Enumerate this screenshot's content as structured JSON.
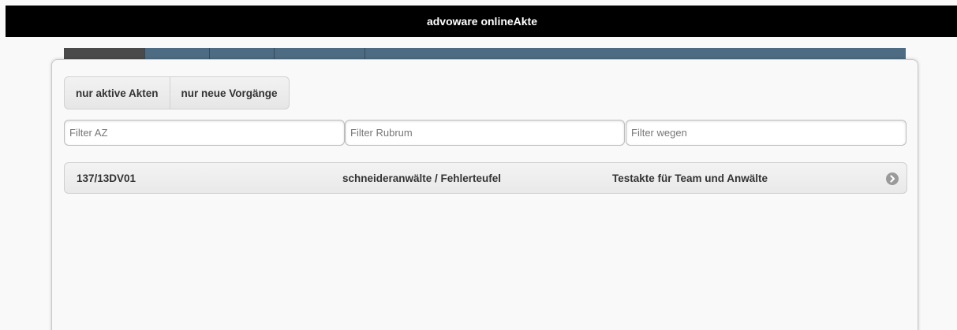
{
  "header": {
    "title": "advoware onlineAkte"
  },
  "tabs": [
    {
      "label": ""
    },
    {
      "label": ""
    },
    {
      "label": ""
    },
    {
      "label": ""
    }
  ],
  "toggles": {
    "active_files": "nur aktive Akten",
    "new_events": "nur neue Vorgänge"
  },
  "filters": {
    "az_placeholder": "Filter AZ",
    "rubrum_placeholder": "Filter Rubrum",
    "wegen_placeholder": "Filter wegen",
    "az_value": "",
    "rubrum_value": "",
    "wegen_value": ""
  },
  "files": [
    {
      "az": "137/13DV01",
      "rubrum": "schneideranwälte / Fehlerteufel",
      "wegen": "Testakte für Team und Anwälte",
      "icon": "chevron-right-circle-icon"
    }
  ],
  "colors": {
    "header_bg": "#000000",
    "tab_bar": "#4d6b82",
    "tab_active": "#4a4a4a"
  }
}
